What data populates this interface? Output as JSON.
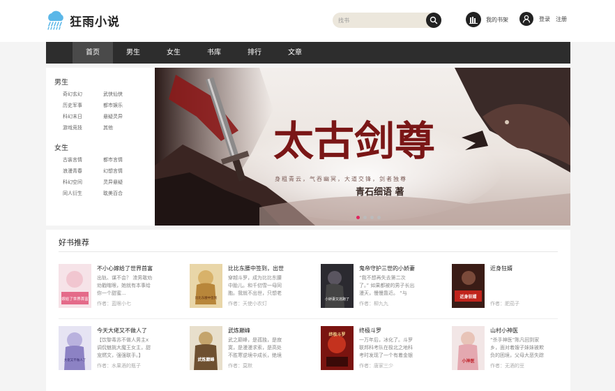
{
  "header": {
    "site_name": "狂雨小说",
    "search_placeholder": "找书",
    "shelf_label": "我的书架",
    "login_label": "登录",
    "register_label": "注册"
  },
  "nav": {
    "items": [
      "首页",
      "男生",
      "女生",
      "书库",
      "排行",
      "文章"
    ]
  },
  "sidebar": {
    "male_title": "男生",
    "male_links": [
      "奇幻玄幻",
      "武侠仙侠",
      "历史军事",
      "都市娱乐",
      "科幻末日",
      "悬疑灵异",
      "游戏竞技",
      "其他"
    ],
    "female_title": "女生",
    "female_links": [
      "古装言情",
      "都市言情",
      "浪漫青春",
      "幻想言情",
      "科幻空间",
      "灵异悬疑",
      "同人衍生",
      "耽美百合"
    ]
  },
  "banner": {
    "title": "太古剑尊",
    "tagline": "身粗青云，气吞幽冥，大道交锋，剑者独尊",
    "author_line": "青石细语 著"
  },
  "recommend": {
    "title": "好书推荐",
    "books": [
      {
        "title": "不小心嫁给了世界首富",
        "desc": "出轨、谋不会？ 渣男敢劝劝戳瞎眼，她就有本事给你一个甜蜜...",
        "author": "作者：蓝眼小七",
        "cover_text": "嫁给了世界首富"
      },
      {
        "title": "比比东腰中签到，出世",
        "desc": "穿越斗罗，成为比比东腰中胎儿。和千仞雪一母同胞。我就不出世，只想老老实实",
        "author": "作者：天使小农灯",
        "cover_text": "比比东腰中签到"
      },
      {
        "title": "鬼帝守护三世的小娇妻",
        "desc": "“我不想再失去第二次了。” 如果都被的男子长出漫天，慢慢靠近。 “与",
        "author": "作者：柳九九",
        "cover_text": "小娇妻又逃跑了"
      },
      {
        "title": "近身狂婿",
        "desc": "",
        "author": "作者：肥茄子",
        "cover_text": "近身狂婿"
      },
      {
        "title": "今天大佬又不做人了",
        "desc": "【饮黎毒苏不做人男主x调侃魅挑大魔王女主，甜宠燃文，强强联手。】 【简介",
        "author": "作者：水果酒的瓶子",
        "cover_text": "大佬又不做人了"
      },
      {
        "title": "武炼巅峰",
        "desc": "武之巅峰，是孤独，是寂寞，是漫漫求索，是高处不胜寒逆境中成长，绝境里求",
        "author": "作者：莫默",
        "cover_text": "武炼巅峰"
      },
      {
        "title": "终极斗罗",
        "desc": "一万年后，冰化了。斗罗联邦科考队在极北之地科考时发现了一个有着金银",
        "author": "作者：唐家三少",
        "cover_text": "终极斗罗"
      },
      {
        "title": "山村小神医",
        "desc": "“杀手神医”陈凡回到家乡，面对着嫂子妹妹被欺负的困境，父母大恶失踪的绝",
        "author": "作者：无酒的豆",
        "cover_text": "小神医"
      }
    ]
  },
  "colors": {
    "nav_bg": "#2d2d2d",
    "dot_active": "#e0245e"
  }
}
